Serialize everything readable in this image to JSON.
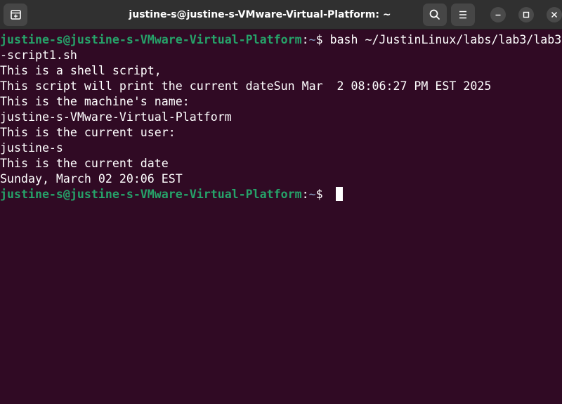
{
  "window": {
    "title": "justine-s@justine-s-VMware-Virtual-Platform: ~"
  },
  "icons": {
    "new_tab": "new-tab-icon",
    "search": "search-icon",
    "menu": "hamburger-menu-icon",
    "minimize": "minimize-icon",
    "maximize": "maximize-icon",
    "close": "close-icon"
  },
  "colors": {
    "background": "#300a24",
    "prompt_user": "#26a269",
    "prompt_path": "#8aa4c8",
    "text": "#ffffff"
  },
  "terminal": {
    "prompt1": {
      "user_host": "justine-s@justine-s-VMware-Virtual-Platform",
      "sep": ":",
      "path": "~",
      "dollar": "$ ",
      "command": "bash ~/JustinLinux/labs/lab3/lab3"
    },
    "wrap": "-script1.sh",
    "output": [
      "This is a shell script,",
      "This script will print the current dateSun Mar  2 08:06:27 PM EST 2025",
      "This is the machine's name:",
      "justine-s-VMware-Virtual-Platform",
      "This is the current user:",
      "justine-s",
      "This is the current date",
      "Sunday, March 02 20:06 EST"
    ],
    "prompt2": {
      "user_host": "justine-s@justine-s-VMware-Virtual-Platform",
      "sep": ":",
      "path": "~",
      "dollar": "$ "
    }
  }
}
